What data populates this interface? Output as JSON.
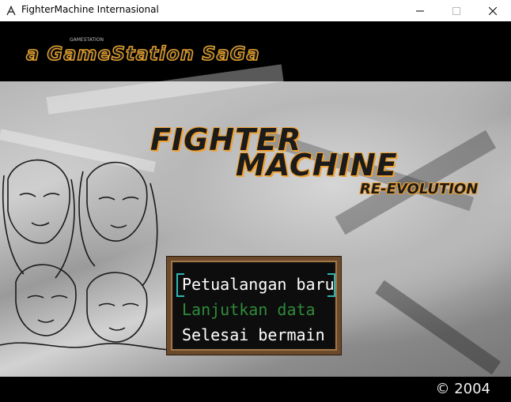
{
  "window": {
    "title": "FighterMachine Internasional",
    "controls": {
      "minimize": "minimize-icon",
      "maximize": "maximize-icon",
      "close": "close-icon"
    }
  },
  "banner": {
    "brand": "a GameStation SaGa",
    "brand_small": "GAMESTATION"
  },
  "logo": {
    "line1": "FIGHTER",
    "line2": "MACHINE",
    "line3": "RE-EVOLUTION"
  },
  "menu": {
    "items": [
      {
        "label": "Petualangan baru",
        "state": "selected"
      },
      {
        "label": "Lanjutkan data",
        "state": "disabled"
      },
      {
        "label": "Selesai bermain",
        "state": "normal"
      }
    ]
  },
  "footer": {
    "copyright": "© 2004"
  },
  "colors": {
    "accent_orange": "#e8a22c",
    "menu_border": "#6b4a2c",
    "cursor": "#2fb4b4",
    "disabled_text": "#2f8a3a"
  }
}
